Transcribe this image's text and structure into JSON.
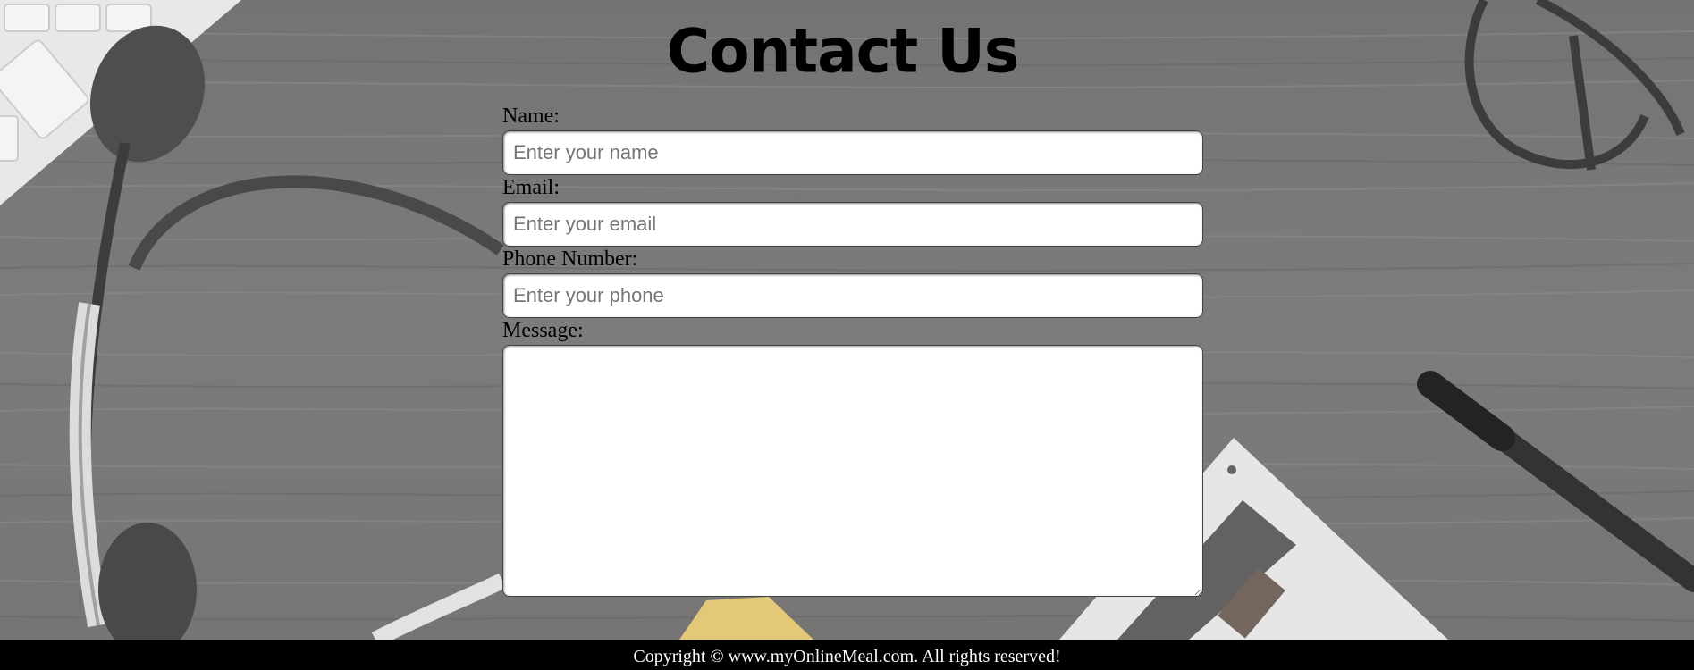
{
  "page": {
    "title": "Contact Us"
  },
  "form": {
    "name_label": "Name:",
    "name_placeholder": "Enter your name",
    "email_label": "Email:",
    "email_placeholder": "Enter your email",
    "phone_label": "Phone Number:",
    "phone_placeholder": "Enter your phone",
    "message_label": "Message:"
  },
  "footer": {
    "copyright": "Copyright © www.myOnlineMeal.com. All rights reserved!"
  },
  "colors": {
    "background_wood": "#6e6c6a",
    "footer_bg": "#000000",
    "footer_text": "#ffffff"
  },
  "background_image": {
    "icons": [
      "keyboard-icon",
      "headset-icon",
      "glasses-icon",
      "pen-icon",
      "calculator-icon"
    ]
  }
}
